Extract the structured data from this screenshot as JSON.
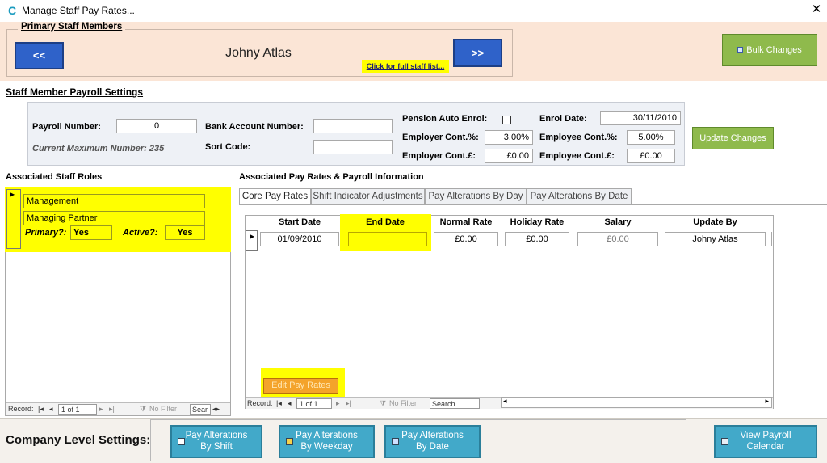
{
  "window": {
    "title": "Manage Staff Pay Rates..."
  },
  "primary": {
    "legend": "Primary Staff Members",
    "prev_label": "<<",
    "next_label": ">>",
    "staff_name": "Johny Atlas",
    "staff_list_link": "Click for full staff list...",
    "bulk_label": "Bulk Changes"
  },
  "payroll": {
    "title": "Staff Member Payroll Settings",
    "payroll_number_label": "Payroll Number:",
    "payroll_number_value": "0",
    "current_max": "Current Maximum Number: 235",
    "bank_label": "Bank Account Number:",
    "bank_value": "",
    "sort_label": "Sort Code:",
    "sort_value": "",
    "pension_label": "Pension Auto Enrol:",
    "employer_pct_label": "Employer Cont.%:",
    "employer_pct_value": "3.00%",
    "employer_gbp_label": "Employer Cont.£:",
    "employer_gbp_value": "£0.00",
    "enrol_label": "Enrol Date:",
    "enrol_value": "30/11/2010",
    "employee_pct_label": "Employee Cont.%:",
    "employee_pct_value": "5.00%",
    "employee_gbp_label": "Employee Cont.£:",
    "employee_gbp_value": "£0.00",
    "update_label": "Update Changes"
  },
  "roles": {
    "title": "Associated Staff Roles",
    "role": "Management",
    "subrole": "Managing Partner",
    "primary_label": "Primary?:",
    "primary_value": "Yes",
    "active_label": "Active?:",
    "active_value": "Yes",
    "nav": {
      "record": "Record:",
      "pos": "1 of 1",
      "filter": "No Filter",
      "search": "Sear"
    }
  },
  "pay": {
    "title": "Associated Pay Rates & Payroll Information",
    "tabs": [
      "Core Pay Rates",
      "Shift Indicator Adjustments",
      "Pay Alterations By Day",
      "Pay Alterations By Date"
    ],
    "headers": {
      "start": "Start Date",
      "end": "End Date",
      "normal": "Normal Rate",
      "holiday": "Holiday Rate",
      "salary": "Salary",
      "update": "Update By"
    },
    "row": {
      "start": "01/09/2010",
      "end": "",
      "normal": "£0.00",
      "holiday": "£0.00",
      "salary": "£0.00",
      "update": "Johny Atlas"
    },
    "edit_label": "Edit Pay Rates",
    "nav": {
      "record": "Record:",
      "pos": "1 of 1",
      "filter": "No Filter",
      "search": "Search"
    }
  },
  "company": {
    "label": "Company Level Settings:",
    "btn_shift_1": "Pay Alterations",
    "btn_shift_2": "By Shift",
    "btn_weekday_1": "Pay Alterations",
    "btn_weekday_2": "By Weekday",
    "btn_date_1": "Pay Alterations",
    "btn_date_2": "By Date",
    "btn_cal_1": "View Payroll",
    "btn_cal_2": "Calendar"
  },
  "colors": {
    "accent_green": "#8fba4c",
    "nav_blue": "#2f62c9",
    "highlight": "#ffff00",
    "button_teal": "#42a9c9",
    "edit_orange": "#f4a32a",
    "band": "#fbe5d6"
  },
  "icons": [
    "app-logo-icon",
    "close-icon",
    "bulk-icon",
    "checkbox-icon",
    "calendar-icon",
    "nav-first-icon",
    "nav-prev-icon",
    "nav-next-icon",
    "nav-last-icon",
    "filter-icon"
  ]
}
